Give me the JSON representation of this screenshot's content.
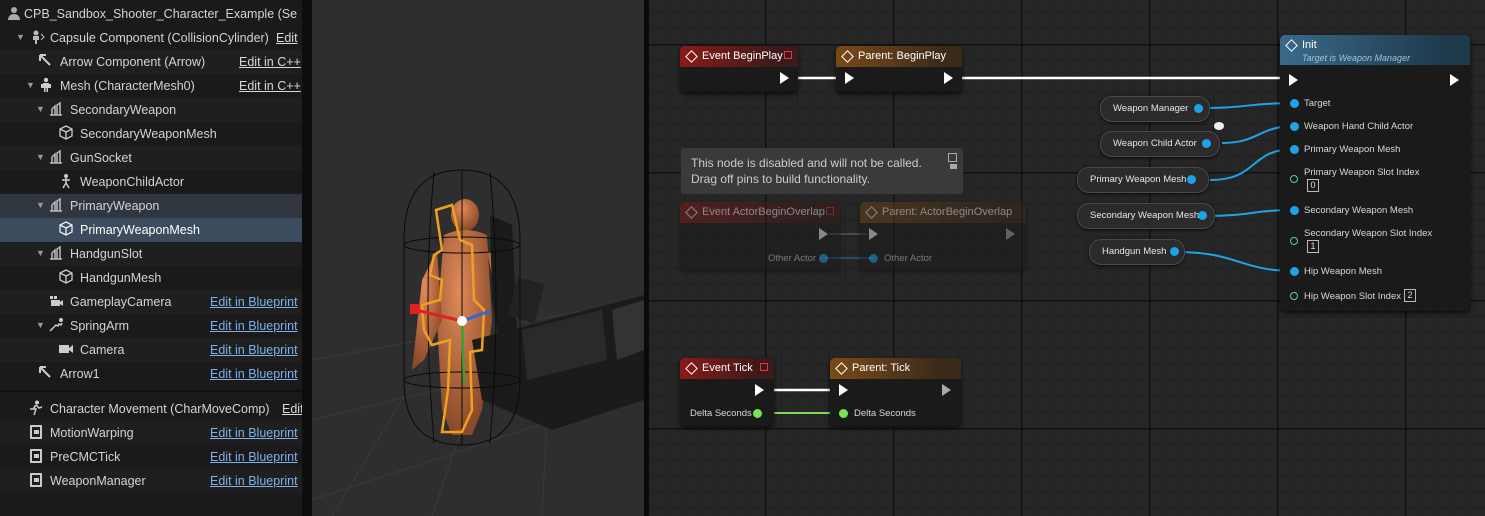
{
  "components": {
    "root": "CPB_Sandbox_Shooter_Character_Example (Se",
    "items": [
      {
        "label": "Capsule Component (CollisionCylinder)",
        "link": "Edit"
      },
      {
        "label": "Arrow Component (Arrow)",
        "link": "Edit in C++"
      },
      {
        "label": "Mesh (CharacterMesh0)",
        "link": "Edit in C++"
      },
      {
        "label": "SecondaryWeapon"
      },
      {
        "label": "SecondaryWeaponMesh"
      },
      {
        "label": "GunSocket"
      },
      {
        "label": "WeaponChildActor"
      },
      {
        "label": "PrimaryWeapon"
      },
      {
        "label": "PrimaryWeaponMesh"
      },
      {
        "label": "HandgunSlot"
      },
      {
        "label": "HandgunMesh"
      },
      {
        "label": "GameplayCamera",
        "link": "Edit in Blueprint"
      },
      {
        "label": "SpringArm",
        "link": "Edit in Blueprint"
      },
      {
        "label": "Camera",
        "link": "Edit in Blueprint"
      },
      {
        "label": "Arrow1",
        "link": "Edit in Blueprint"
      },
      {
        "label": "Character Movement (CharMoveComp)",
        "link": "Edit"
      },
      {
        "label": "MotionWarping",
        "link": "Edit in Blueprint"
      },
      {
        "label": "PreCMCTick",
        "link": "Edit in Blueprint"
      },
      {
        "label": "WeaponManager",
        "link": "Edit in Blueprint"
      }
    ]
  },
  "graph": {
    "begin_play": "Event BeginPlay",
    "parent_begin_play": "Parent: BeginPlay",
    "init_title": "Init",
    "init_subtitle": "Target is Weapon Manager",
    "init_pins": {
      "target": "Target",
      "weapon_hand_child_actor": "Weapon Hand Child Actor",
      "primary_weapon_mesh": "Primary Weapon Mesh",
      "primary_slot_index": "Primary Weapon Slot Index",
      "primary_slot_value": "0",
      "secondary_weapon_mesh": "Secondary Weapon Mesh",
      "secondary_slot_index": "Secondary Weapon Slot Index",
      "secondary_slot_value": "1",
      "hip_weapon_mesh": "Hip Weapon Mesh",
      "hip_slot_index": "Hip Weapon Slot Index",
      "hip_slot_value": "2"
    },
    "vars": {
      "weapon_manager": "Weapon Manager",
      "weapon_child_actor": "Weapon Child Actor",
      "primary_weapon_mesh": "Primary Weapon Mesh",
      "secondary_weapon_mesh": "Secondary Weapon Mesh",
      "handgun_mesh": "Handgun Mesh"
    },
    "comment_line1": "This node is disabled and will not be called.",
    "comment_line2": "Drag off pins to build functionality.",
    "overlap": "Event ActorBeginOverlap",
    "parent_overlap": "Parent: ActorBeginOverlap",
    "other_actor": "Other Actor",
    "tick": "Event Tick",
    "parent_tick": "Parent: Tick",
    "delta_seconds": "Delta Seconds"
  },
  "colors": {
    "object_pin": "#1fa3e8",
    "float_pin": "#7ae05a",
    "int_pin": "#5cd18e",
    "event_header": "#8b1a1a",
    "parent_header": "#7a4a18",
    "function_header": "#3a6a8a",
    "selection": "#3d4b5f"
  }
}
